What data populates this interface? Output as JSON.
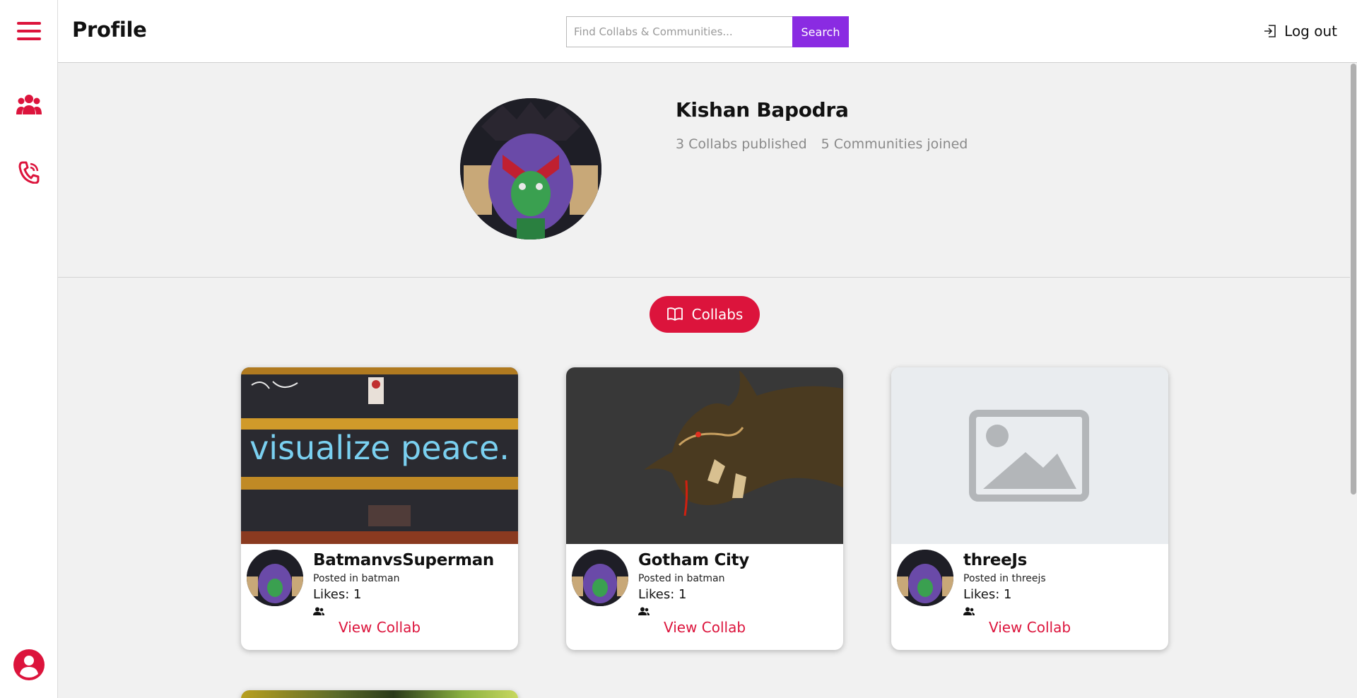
{
  "header": {
    "title": "Profile",
    "search_placeholder": "Find Collabs & Communities...",
    "search_button": "Search",
    "logout_label": "Log out"
  },
  "sidebar": {
    "items": [
      {
        "icon": "hamburger-menu-icon"
      },
      {
        "icon": "users-icon"
      },
      {
        "icon": "phone-icon"
      },
      {
        "icon": "account-circle-icon"
      }
    ],
    "accent_color": "#dc143c"
  },
  "profile": {
    "name": "Kishan Bapodra",
    "collabs_published": "3 Collabs published",
    "communities_joined": "5 Communities joined"
  },
  "tabs": {
    "collabs_label": "Collabs",
    "active_color": "#dc143c"
  },
  "collabs": [
    {
      "title": "BatmanvsSuperman",
      "posted_in": "Posted in batman",
      "likes": "Likes: 1",
      "view_label": "View Collab",
      "image": "graffiti-photo",
      "image_text": "visualize peace."
    },
    {
      "title": "Gotham City",
      "posted_in": "Posted in batman",
      "likes": "Likes: 1",
      "view_label": "View Collab",
      "image": "dragon-illustration"
    },
    {
      "title": "threeJs",
      "posted_in": "Posted in threejs",
      "likes": "Likes: 1",
      "view_label": "View Collab",
      "image": "image-placeholder-icon"
    }
  ],
  "colors": {
    "search_button": "#8a2be2",
    "background": "#f1f1f1"
  }
}
